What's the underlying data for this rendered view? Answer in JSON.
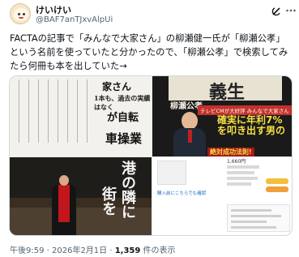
{
  "author": {
    "display_name": "けいけい",
    "handle": "@BAF7anTJxvAlpUi"
  },
  "tweet": {
    "text": "FACTAの記事で「みんなで大家さん」の柳瀬健一氏が「柳瀬公孝」という名前を使っていたと分かったので、「柳瀬公孝」で検索してみたら何冊も本を出していた→"
  },
  "media": {
    "magazine": {
      "headline_1": "家さん",
      "headline_2": "1本も、過去の実績はなく",
      "headline_3": "が自転",
      "headline_4": "車操業"
    },
    "cover": {
      "big_text": "義生",
      "tv_band": "テレビCMが大好評 みんなで大家さん",
      "claim": "確実に年利7%を叩き出す男の",
      "band": "絶対成功法則!",
      "author": "柳瀬公孝"
    },
    "dark_book": {
      "title_col1": "港の隣に",
      "title_col2": "街を"
    },
    "web": {
      "price": "1,660円",
      "link": "購入前にこちらでも確認"
    }
  },
  "meta": {
    "time": "午後9:59 · 2026年2月1日 · ",
    "views": "1,359",
    "views_suffix": " 件の表示"
  },
  "icons": {
    "grok": "grok-icon",
    "more": "more-icon"
  },
  "colors": {
    "text_primary": "#0f1419",
    "text_secondary": "#536471",
    "border": "#cfd9de"
  }
}
